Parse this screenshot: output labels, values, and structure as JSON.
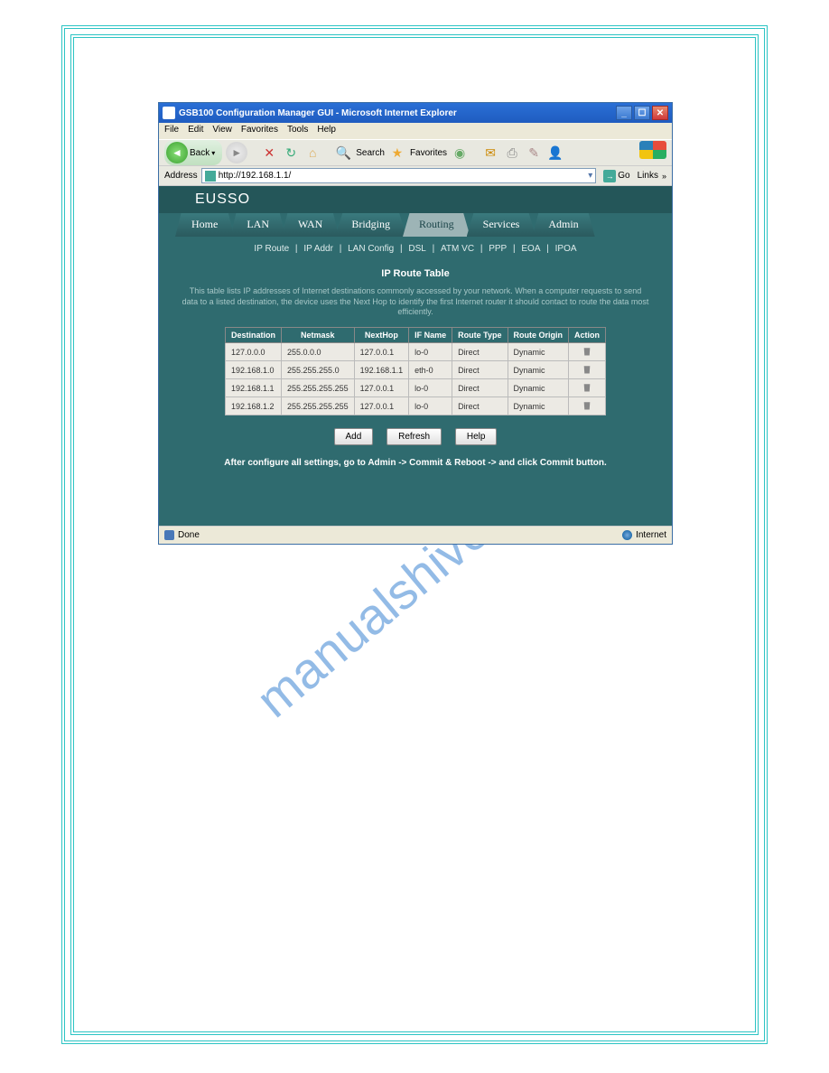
{
  "window": {
    "title": "GSB100 Configuration Manager GUI - Microsoft Internet Explorer"
  },
  "menubar": [
    "File",
    "Edit",
    "View",
    "Favorites",
    "Tools",
    "Help"
  ],
  "toolbar": {
    "back": "Back",
    "search": "Search",
    "favorites": "Favorites"
  },
  "addressbar": {
    "label": "Address",
    "url": "http://192.168.1.1/",
    "go": "Go",
    "links": "Links"
  },
  "page": {
    "logo": "EUSSO",
    "main_tabs": [
      "Home",
      "LAN",
      "WAN",
      "Bridging",
      "Routing",
      "Services",
      "Admin"
    ],
    "active_tab": "Routing",
    "sub_tabs": [
      "IP Route",
      "IP Addr",
      "LAN Config",
      "DSL",
      "ATM VC",
      "PPP",
      "EOA",
      "IPOA"
    ],
    "title": "IP Route Table",
    "description": "This table lists IP addresses of Internet destinations commonly accessed by your network. When a computer requests to send data to a listed destination, the device uses the Next Hop to identify the first Internet router it should contact to route the data most efficiently.",
    "table": {
      "headers": [
        "Destination",
        "Netmask",
        "NextHop",
        "IF Name",
        "Route Type",
        "Route Origin",
        "Action"
      ],
      "rows": [
        [
          "127.0.0.0",
          "255.0.0.0",
          "127.0.0.1",
          "lo-0",
          "Direct",
          "Dynamic"
        ],
        [
          "192.168.1.0",
          "255.255.255.0",
          "192.168.1.1",
          "eth-0",
          "Direct",
          "Dynamic"
        ],
        [
          "192.168.1.1",
          "255.255.255.255",
          "127.0.0.1",
          "lo-0",
          "Direct",
          "Dynamic"
        ],
        [
          "192.168.1.2",
          "255.255.255.255",
          "127.0.0.1",
          "lo-0",
          "Direct",
          "Dynamic"
        ]
      ]
    },
    "buttons": {
      "add": "Add",
      "refresh": "Refresh",
      "help": "Help"
    },
    "footer_note": "After configure all settings, go to Admin -> Commit & Reboot -> and click Commit button."
  },
  "statusbar": {
    "status": "Done",
    "zone": "Internet"
  },
  "watermark": "manualshive.com"
}
